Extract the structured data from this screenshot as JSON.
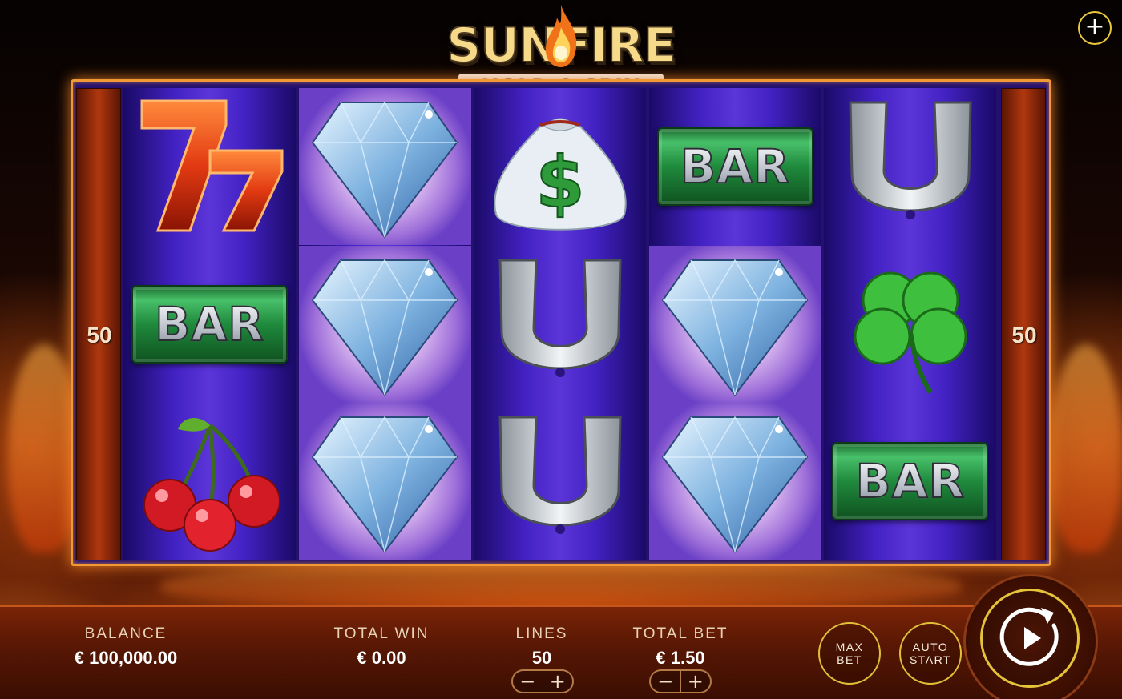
{
  "game": {
    "logo_main": "SUNFIRE",
    "logo_sub": "HOLD & SPIN"
  },
  "header": {
    "menu_icon": "plus-icon",
    "menu_label": "+"
  },
  "paylines": {
    "left": "50",
    "right": "50"
  },
  "reels": [
    [
      "seven",
      "bar",
      "cherries"
    ],
    [
      "diamond",
      "diamond",
      "diamond"
    ],
    [
      "money-bag",
      "horseshoe",
      "horseshoe"
    ],
    [
      "bar",
      "diamond",
      "diamond"
    ],
    [
      "horseshoe",
      "clover",
      "bar"
    ]
  ],
  "bar_text": "BAR",
  "money_bag_symbol": "$",
  "panel": {
    "balance_label": "BALANCE",
    "balance_value": "€ 100,000.00",
    "total_win_label": "TOTAL WIN",
    "total_win_value": "€ 0.00",
    "lines_label": "LINES",
    "lines_value": "50",
    "total_bet_label": "TOTAL BET",
    "total_bet_value": "€ 1.50",
    "minus": "−",
    "plus": "+",
    "max_bet_label": "MAX BET",
    "auto_start_label": "AUTO START",
    "spin_icon": "spin-play-icon"
  },
  "colors": {
    "accent_gold": "#e6c43a",
    "frame_orange": "#f19a35",
    "reel_purple": "#4322c4",
    "bar_green": "#1f8a3c"
  }
}
